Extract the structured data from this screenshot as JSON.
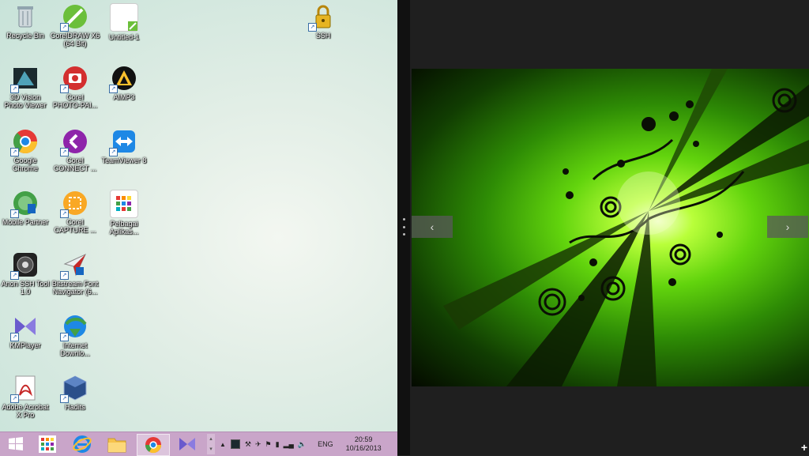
{
  "desktop": {
    "icons": [
      {
        "label": "Recycle Bin",
        "icon": "recycle-bin-icon"
      },
      {
        "label": "CorelDRAW X6\n(64 Bit)",
        "icon": "coreldraw-icon"
      },
      {
        "label": "Untitled-1",
        "icon": "untitled-file-icon"
      },
      {
        "label": "SSH",
        "icon": "lock-icon"
      },
      {
        "label": "3D Vision\nPhoto Viewer",
        "icon": "3d-vision-icon"
      },
      {
        "label": "Corel\nPHOTO-PAI...",
        "icon": "corel-photo-paint-icon"
      },
      {
        "label": "AIMP3",
        "icon": "aimp-icon"
      },
      {
        "label": "Google\nChrome",
        "icon": "chrome-icon"
      },
      {
        "label": "Corel\nCONNECT ...",
        "icon": "corel-connect-icon"
      },
      {
        "label": "TeamViewer 8",
        "icon": "teamviewer-icon"
      },
      {
        "label": "Mobile Partner",
        "icon": "mobile-partner-icon"
      },
      {
        "label": "Corel\nCAPTURE ...",
        "icon": "corel-capture-icon"
      },
      {
        "label": "Pelbagai\nAplikas...",
        "icon": "apps-icon"
      },
      {
        "label": "Anon SSH Tool\n1.0",
        "icon": "anon-ssh-icon"
      },
      {
        "label": "Bitstream Font\nNavigator (6...",
        "icon": "bitstream-icon"
      },
      {
        "label": "KMPlayer",
        "icon": "kmplayer-icon"
      },
      {
        "label": "Internet\nDownlo...",
        "icon": "idm-icon"
      },
      {
        "label": "Adobe Acrobat\nX Pro",
        "icon": "acrobat-icon"
      },
      {
        "label": "Hadits",
        "icon": "virtualbox-icon"
      }
    ]
  },
  "taskbar": {
    "buttons": [
      {
        "name": "start-button",
        "icon": "windows-logo-icon"
      },
      {
        "name": "apps-taskbar-button",
        "icon": "apps-grid-icon"
      },
      {
        "name": "ie-taskbar-button",
        "icon": "internet-explorer-icon"
      },
      {
        "name": "explorer-taskbar-button",
        "icon": "folder-icon"
      },
      {
        "name": "chrome-taskbar-button",
        "icon": "chrome-icon"
      },
      {
        "name": "kmplayer-taskbar-button",
        "icon": "kmplayer-icon"
      }
    ],
    "language": "ENG",
    "time": "20:59",
    "date": "10/16/2013"
  },
  "viewer": {
    "prev_glyph": "‹",
    "next_glyph": "›",
    "plus_glyph": "+"
  },
  "colors": {
    "taskbar": "#c9a5c9",
    "desktop": "#dcebe3",
    "photo_accent": "#7de812"
  }
}
